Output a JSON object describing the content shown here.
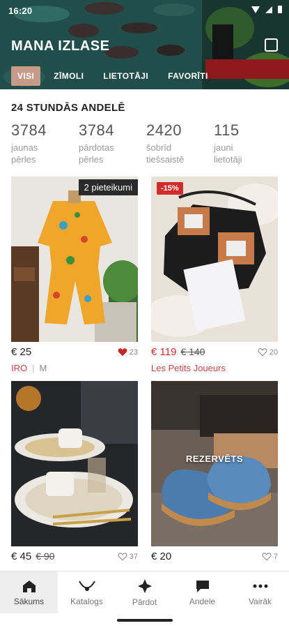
{
  "status": {
    "time": "16:20"
  },
  "header": {
    "title": "MANA IZLASE",
    "tabs": [
      {
        "label": "VISI",
        "active": true
      },
      {
        "label": "ZĪMOLI",
        "active": false
      },
      {
        "label": "LIETOTĀJI",
        "active": false
      },
      {
        "label": "FAVORĪTI",
        "active": false
      }
    ]
  },
  "stats_section": {
    "title": "24 STUNDĀS ANDELĒ",
    "items": [
      {
        "value": "3784",
        "label_line1": "jaunas",
        "label_line2": "pērles"
      },
      {
        "value": "3784",
        "label_line1": "pārdotas",
        "label_line2": "pērles"
      },
      {
        "value": "2420",
        "label_line1": "šobrīd",
        "label_line2": "tiešsaistē"
      },
      {
        "value": "115",
        "label_line1": "jauni",
        "label_line2": "lietotāji"
      }
    ]
  },
  "products": [
    {
      "badge": "2 pieteikumi",
      "price": "€ 25",
      "old_price": "",
      "likes": "23",
      "liked": true,
      "brand": "IRO",
      "size": "M"
    },
    {
      "badge": "-15%",
      "price": "€ 119",
      "old_price": "€ 140",
      "likes": "20",
      "liked": false,
      "brand": "Les Petits Joueurs",
      "size": ""
    },
    {
      "badge": "",
      "price": "€ 45",
      "old_price": "€ 90",
      "likes": "37",
      "liked": false,
      "brand": "",
      "size": ""
    },
    {
      "badge": "REZERVĒTS",
      "price": "€ 20",
      "old_price": "",
      "likes": "7",
      "liked": false,
      "brand": "",
      "size": ""
    }
  ],
  "bottom_nav": [
    {
      "label": "Sākums",
      "icon": "home-icon",
      "active": true
    },
    {
      "label": "Katalogs",
      "icon": "necklace-icon",
      "active": false
    },
    {
      "label": "Pārdot",
      "icon": "sell-icon",
      "active": false
    },
    {
      "label": "Andele",
      "icon": "chat-icon",
      "active": false
    },
    {
      "label": "Vairāk",
      "icon": "more-icon",
      "active": false
    }
  ],
  "colors": {
    "accent": "#d12b2b",
    "tab_active": "#c59a86",
    "header_bg": "#1f4f4c"
  }
}
